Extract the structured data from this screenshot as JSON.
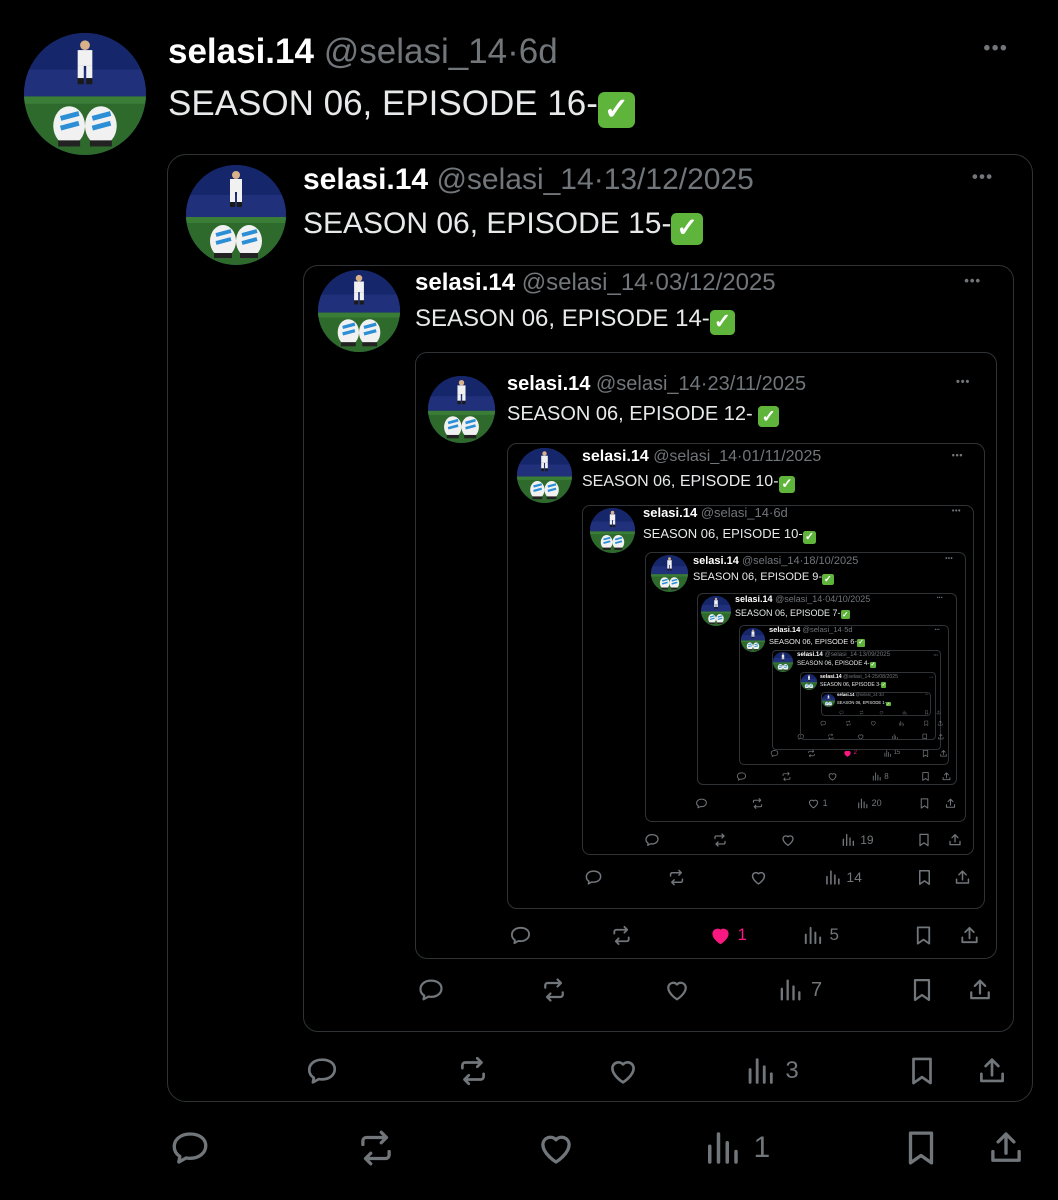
{
  "colors": {
    "background": "#000000",
    "name_text": "#ffffff",
    "body_text": "#e7e9ea",
    "muted_text": "#71767b",
    "border": "#2f3336",
    "like_active": "#f91880",
    "check_green": "#5fb43b"
  },
  "check_glyph": "✓",
  "more_label": "•••",
  "icons": [
    "reply-icon",
    "repost-icon",
    "like-icon",
    "views-icon",
    "bookmark-icon",
    "share-icon",
    "more-icon",
    "check-emoji-icon"
  ],
  "posts": [
    {
      "name": "selasi.14",
      "handle": "@selasi_14",
      "sep": "·",
      "date": "6d",
      "text": "SEASON 06, EPISODE 16-",
      "likes": "",
      "liked": false,
      "views": "1"
    },
    {
      "name": "selasi.14",
      "handle": "@selasi_14",
      "sep": "·",
      "date": "13/12/2025",
      "text": "SEASON 06, EPISODE 15-",
      "likes": "",
      "liked": false,
      "views": "3"
    },
    {
      "name": "selasi.14",
      "handle": "@selasi_14",
      "sep": "·",
      "date": "03/12/2025",
      "text": "SEASON 06, EPISODE 14-",
      "likes": "",
      "liked": false,
      "views": "7"
    },
    {
      "name": "selasi.14",
      "handle": "@selasi_14",
      "sep": "·",
      "date": "23/11/2025",
      "text": "SEASON 06, EPISODE 12- ",
      "likes": "1",
      "liked": true,
      "views": "5"
    },
    {
      "name": "selasi.14",
      "handle": "@selasi_14",
      "sep": "·",
      "date": "01/11/2025",
      "text": "SEASON 06, EPISODE 10-",
      "likes": "",
      "liked": false,
      "views": "14"
    },
    {
      "name": "selasi.14",
      "handle": "@selasi_14",
      "sep": "·",
      "date": "6d",
      "text": "SEASON 06, EPISODE 10-",
      "likes": "",
      "liked": false,
      "views": "19"
    },
    {
      "name": "selasi.14",
      "handle": "@selasi_14",
      "sep": "·",
      "date": "18/10/2025",
      "text": "SEASON 06, EPISODE 9-",
      "likes": "1",
      "liked": false,
      "views": "20"
    },
    {
      "name": "selasi.14",
      "handle": "@selasi_14",
      "sep": "·",
      "date": "04/10/2025",
      "text": "SEASON 06, EPISODE 7-",
      "likes": "",
      "liked": false,
      "views": "8"
    },
    {
      "name": "selasi.14",
      "handle": "@selasi_14",
      "sep": "·",
      "date": "5d",
      "text": "SEASON 06, EPISODE 6-",
      "likes": "2",
      "liked": true,
      "views": "15"
    },
    {
      "name": "selasi.14",
      "handle": "@selasi_14",
      "sep": "·",
      "date": "13/09/2025",
      "text": "SEASON 06, EPISODE 4-",
      "likes": "",
      "liked": false,
      "views": ""
    },
    {
      "name": "selasi.14",
      "handle": "@selasi_14",
      "sep": "·",
      "date": "25/08/2025",
      "text": "SEASON 06, EPISODE 3-",
      "likes": "",
      "liked": false,
      "views": ""
    },
    {
      "name": "selasi.14",
      "handle": "@selasi_14",
      "sep": "·",
      "date": "3d",
      "text": "SEASON 06, EPISODE 1-",
      "likes": "",
      "liked": false,
      "views": ""
    }
  ]
}
